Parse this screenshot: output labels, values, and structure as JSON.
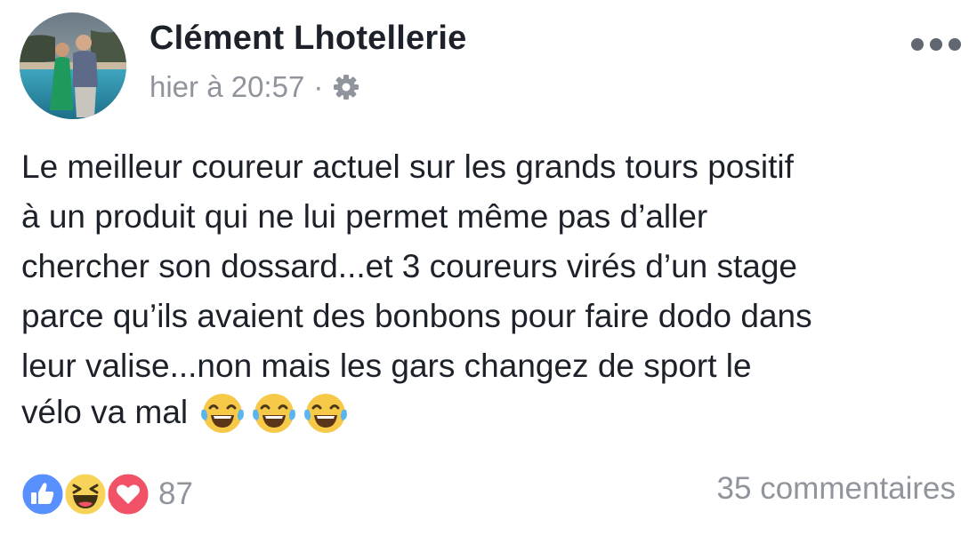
{
  "post": {
    "author": "Clément Lhotellerie",
    "timestamp": "hier à 20:57",
    "separator": "·",
    "privacy_icon": "gear-icon",
    "more_icon": "ellipsis-icon",
    "body_lines": "Le meilleur coureur actuel sur les grands tours positif\nà un produit qui ne lui permet même pas d’aller\nchercher son dossard...et 3 coureurs virés d’un stage\nparce qu’ils avaient des bonbons pour faire dodo dans\nleur valise...non mais les gars changez de sport le",
    "body_last_line": "vélo va mal",
    "emoji": [
      "tears-of-joy-emoji",
      "tears-of-joy-emoji",
      "tears-of-joy-emoji"
    ]
  },
  "footer": {
    "reaction_icons": [
      "like-reaction-icon",
      "haha-reaction-icon",
      "love-reaction-icon"
    ],
    "reaction_count": "87",
    "comments": "35 commentaires"
  },
  "colors": {
    "text": "#1d2129",
    "muted": "#90949c",
    "like": "#5890ff",
    "haha": "#f7d35a",
    "love": "#f25268"
  }
}
